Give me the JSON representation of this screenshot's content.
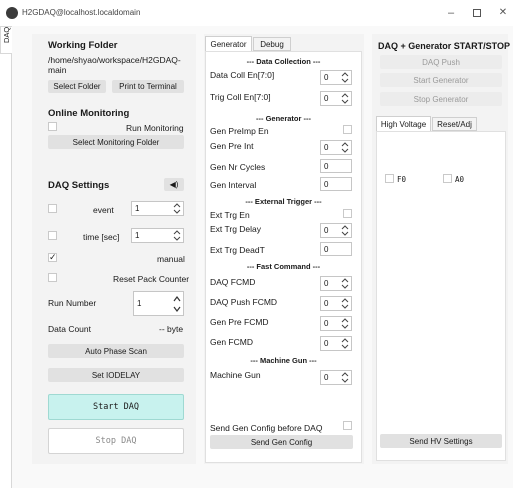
{
  "window": {
    "title": "H2GDAQ@localhost.localdomain",
    "side_tab": "DAQ"
  },
  "left": {
    "working_folder_title": "Working Folder",
    "working_folder_path": "/home/shyao/workspace/H2GDAQ-main",
    "select_folder": "Select Folder",
    "print_to_terminal": "Print to Terminal",
    "online_monitoring_title": "Online Monitoring",
    "run_monitoring": "Run Monitoring",
    "select_monitoring_folder": "Select Monitoring Folder",
    "daq_settings_title": "DAQ Settings",
    "event_label": "event",
    "event_value": "1",
    "time_label": "time [sec]",
    "time_value": "1",
    "manual_label": "manual",
    "reset_pack_counter": "Reset Pack Counter",
    "run_number_label": "Run Number",
    "run_number_value": "1",
    "data_count_label": "Data Count",
    "data_count_value": "-- byte",
    "auto_phase_scan": "Auto Phase Scan",
    "set_iodelay": "Set IODELAY",
    "start_daq": "Start DAQ",
    "stop_daq": "Stop DAQ"
  },
  "middle": {
    "tabs": [
      "Generator",
      "Debug"
    ],
    "sec_data_collection": "--- Data Collection ---",
    "data_coll_en": "Data Coll En[7:0]",
    "data_coll_en_value": "0",
    "trig_coll_en": "Trig Coll En[7:0]",
    "trig_coll_en_value": "0",
    "sec_generator": "--- Generator ---",
    "gen_preimp_en": "Gen PreImp En",
    "gen_pre_int": "Gen Pre Int",
    "gen_pre_int_value": "0",
    "gen_nr_cycles": "Gen Nr Cycles",
    "gen_nr_cycles_value": "0",
    "gen_interval": "Gen Interval",
    "gen_interval_value": "0",
    "sec_external_trigger": "--- External Trigger ---",
    "ext_trg_en": "Ext Trg En",
    "ext_trg_delay": "Ext Trg Delay",
    "ext_trg_delay_value": "0",
    "ext_trg_deadt": "Ext Trg DeadT",
    "ext_trg_deadt_value": "0",
    "sec_fast_command": "--- Fast Command ---",
    "daq_fcmd": "DAQ FCMD",
    "daq_fcmd_value": "0",
    "daq_push_fcmd": "DAQ Push FCMD",
    "daq_push_fcmd_value": "0",
    "gen_pre_fcmd": "Gen Pre FCMD",
    "gen_pre_fcmd_value": "0",
    "gen_fcmd": "Gen FCMD",
    "gen_fcmd_value": "0",
    "sec_machine_gun": "--- Machine Gun ---",
    "machine_gun": "Machine Gun",
    "machine_gun_value": "0",
    "send_gen_config_before_daq": "Send Gen Config before DAQ",
    "send_gen_config": "Send Gen Config"
  },
  "right": {
    "title": "DAQ + Generator START/STOP",
    "daq_push": "DAQ Push",
    "start_generator": "Start Generator",
    "stop_generator": "Stop Generator",
    "tabs": [
      "High Voltage",
      "Reset/Adj"
    ],
    "f0_label": "F0",
    "a0_label": "A0",
    "send_hv_settings": "Send HV Settings"
  },
  "colors": {
    "start_button_bg": "#c8f2ee",
    "panel_bg": "#f3f3f3",
    "button_bg": "#e1e1e1"
  }
}
